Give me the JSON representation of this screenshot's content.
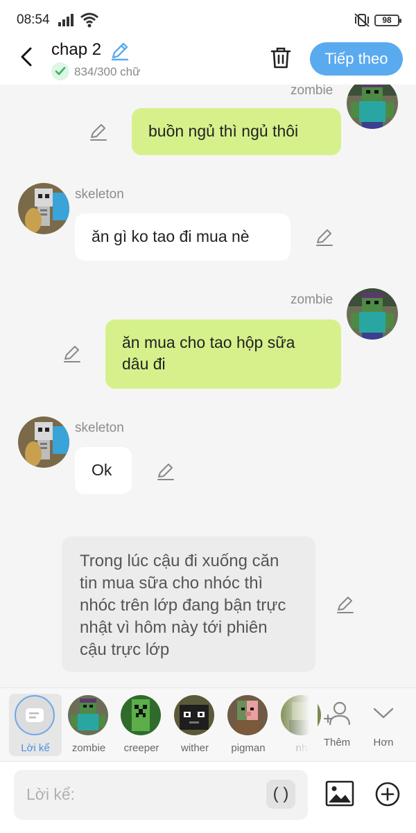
{
  "status_bar": {
    "time": "08:54",
    "battery": "98"
  },
  "header": {
    "title": "chap 2",
    "word_count": "834/300 chữ",
    "next_label": "Tiếp theo"
  },
  "messages": [
    {
      "side": "right",
      "sender": "zombie",
      "text": "buồn ngủ thì ngủ thôi"
    },
    {
      "side": "left",
      "sender": "skeleton",
      "text": "ăn gì ko tao đi mua nè"
    },
    {
      "side": "right",
      "sender": "zombie",
      "text": "ăn mua cho tao hộp sữa dâu đi"
    },
    {
      "side": "left",
      "sender": "skeleton",
      "text": "Ok"
    },
    {
      "side": "narration",
      "text": "Trong lúc cậu đi xuống căn tin mua sữa cho nhóc thì nhóc trên lớp đang bận trực nhật vì hôm này tới phiên cậu trực lớp"
    }
  ],
  "characters": [
    {
      "label": "Lời kể",
      "icon": "narration-icon",
      "selected": true
    },
    {
      "label": "zombie",
      "icon": "zombie-avatar"
    },
    {
      "label": "creeper",
      "icon": "creeper-avatar"
    },
    {
      "label": "wither",
      "icon": "wither-avatar"
    },
    {
      "label": "pigman",
      "icon": "pigman-avatar"
    },
    {
      "label": "nh",
      "icon": "character-avatar"
    }
  ],
  "char_actions": {
    "add_label": "Thêm",
    "more_label": "Hơn"
  },
  "input": {
    "placeholder": "Lời kể:",
    "paren_label": "( )"
  },
  "colors": {
    "accent": "#5aaaf0",
    "right_bubble": "#d6f18b",
    "left_bubble": "#ffffff",
    "narration_bubble": "#ececec"
  }
}
